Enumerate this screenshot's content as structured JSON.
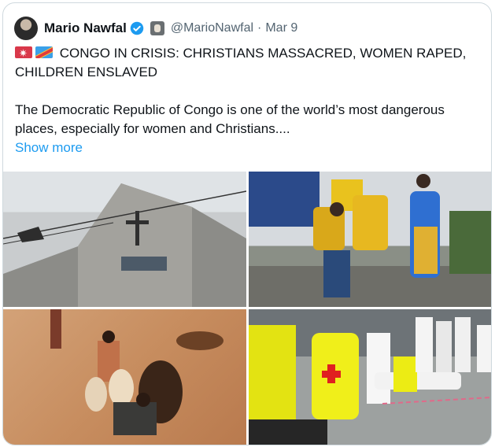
{
  "post": {
    "author_name": "Mario Nawfal",
    "handle": "@MarioNawfal",
    "separator": "·",
    "date": "Mar 9",
    "headline": "CONGO IN CRISIS: CHRISTIANS MASSACRED, WOMEN RAPED, CHILDREN ENSLAVED",
    "body": "The Democratic Republic of Congo is one of the world’s most dangerous places, especially for women and Christians....",
    "show_more": "Show more",
    "icons": [
      "verified-badge-icon",
      "affiliate-badge-icon",
      "sos-flag-icon",
      "drc-flag-icon"
    ]
  },
  "colors": {
    "link": "#1d9bf0",
    "text": "#0f1419",
    "muted": "#536471",
    "verified": "#1d9bf0"
  }
}
